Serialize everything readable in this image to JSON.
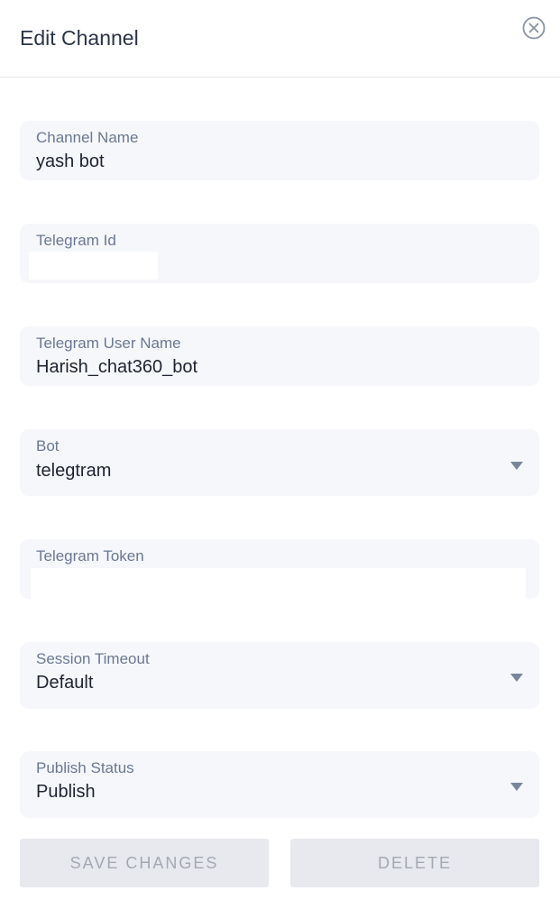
{
  "header": {
    "title": "Edit Channel",
    "close_icon": "close-circle-icon"
  },
  "fields": {
    "channel_name": {
      "label": "Channel Name",
      "value": "yash bot"
    },
    "telegram_id": {
      "label": "Telegram Id",
      "value": ""
    },
    "telegram_user_name": {
      "label": "Telegram User Name",
      "value": "Harish_chat360_bot"
    },
    "bot": {
      "label": "Bot",
      "value": "telegtram"
    },
    "telegram_token": {
      "label": "Telegram Token",
      "value": ""
    },
    "session_timeout": {
      "label": "Session Timeout",
      "value": "Default"
    },
    "publish_status": {
      "label": "Publish Status",
      "value": "Publish"
    }
  },
  "actions": {
    "save_label": "SAVE CHANGES",
    "delete_label": "DELETE"
  },
  "colors": {
    "field_bg": "#f6f7fb",
    "label": "#6b7893",
    "button_bg": "#e8e9ee"
  }
}
